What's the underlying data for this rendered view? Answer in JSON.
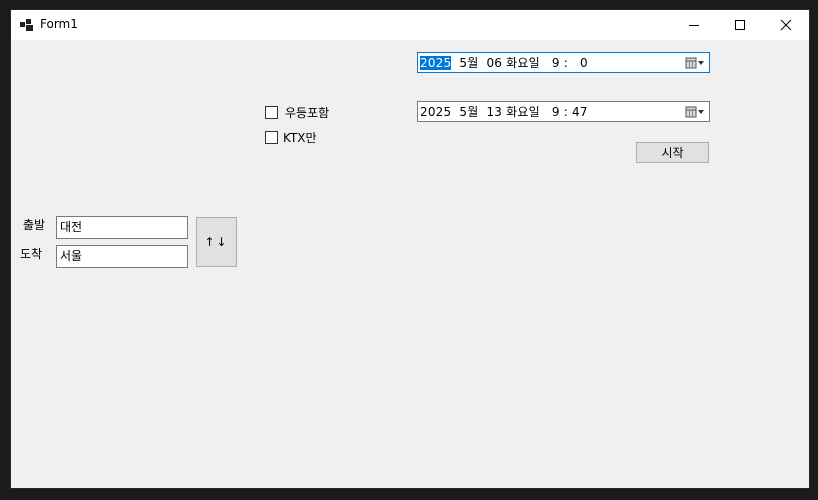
{
  "window": {
    "title": "Form1",
    "icons": {
      "app": "app-icon",
      "minimize": "minimize-icon",
      "maximize": "maximize-icon",
      "close": "close-icon"
    }
  },
  "datetime_start": {
    "year": "2025",
    "rest": "  5월  06 화요일   9 :   0",
    "icon": "calendar-dropdown-icon"
  },
  "datetime_end": {
    "value": "2025  5월  13 화요일   9 : 47",
    "icon": "calendar-dropdown-icon"
  },
  "options": {
    "first_class_label": "우등포함",
    "first_class_checked": false,
    "ktx_only_label": "KTX만",
    "ktx_only_checked": false
  },
  "start_button_label": "시작",
  "route": {
    "departure_label": "출발",
    "departure_value": "대전",
    "arrival_label": "도착",
    "arrival_value": "서울",
    "swap_button_label": "↑↓"
  },
  "colors": {
    "accent": "#0078d7",
    "form_bg": "#f0f0f0",
    "button_bg": "#e1e1e1"
  }
}
